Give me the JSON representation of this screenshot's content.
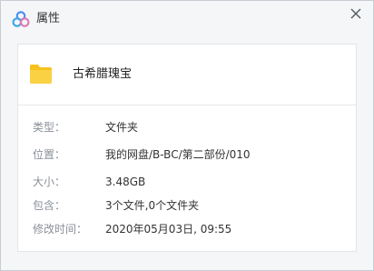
{
  "window": {
    "title": "属性",
    "app_icon": "cloud-drive-logo-icon",
    "close_icon": "close-icon"
  },
  "file": {
    "icon": "folder-icon",
    "name": "古希腊瑰宝"
  },
  "properties": [
    {
      "label": "类型：",
      "value": "文件夹"
    },
    {
      "label": "位置：",
      "value": "我的网盘/B-BC/第二部份/010"
    },
    {
      "label": "大小：",
      "value": "3.48GB"
    },
    {
      "label": "包含：",
      "value": "3个文件,0个文件夹"
    },
    {
      "label": "修改时间：",
      "value": "2020年05月03日, 09:55"
    }
  ],
  "colors": {
    "folder": "#f8c21c",
    "logo_blue": "#4b8ff0",
    "logo_pink": "#e07ab3",
    "label_text": "#8a8f98"
  }
}
